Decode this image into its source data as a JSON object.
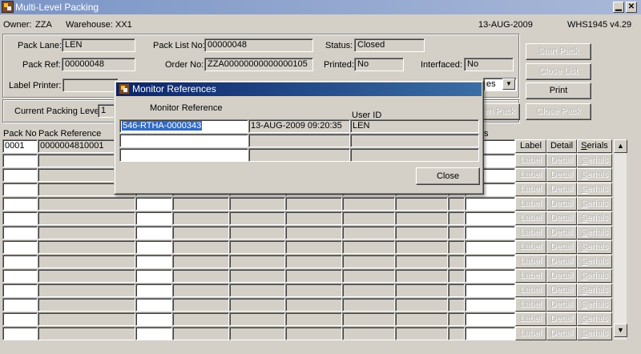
{
  "window": {
    "title": "Multi-Level Packing",
    "minimize": "▁",
    "close": "✕"
  },
  "infobar": {
    "owner_label": "Owner:",
    "owner": "ZZA",
    "warehouse_label": "Warehouse:",
    "warehouse": "XX1",
    "date": "13-AUG-2009",
    "version": "WHS1945  v4.29"
  },
  "form": {
    "pack_lane_label": "Pack Lane:",
    "pack_lane": "LEN",
    "pack_list_no_label": "Pack List No:",
    "pack_list_no": "00000048",
    "status_label": "Status:",
    "status": "Closed",
    "pack_ref_label": "Pack Ref:",
    "pack_ref": "00000048",
    "order_no_label": "Order No:",
    "order_no": "ZZA00000000000000105",
    "printed_label": "Printed:",
    "printed": "No",
    "interfaced_label": "Interfaced:",
    "interfaced": "No",
    "label_printer_label": "Label Printer:",
    "label_printer": "",
    "dropdown_value": "es",
    "current_level_label": "Current Packing Level",
    "current_level": "1"
  },
  "buttons": {
    "start_pack": "Start Pack",
    "close_list": "Close List",
    "print": "Print",
    "open_pack": "en Pack",
    "close_pack": "Close Pack"
  },
  "grid": {
    "headers": {
      "pack_no": "Pack No",
      "pack_reference": "Pack Reference",
      "status_frag": "s"
    },
    "row1": {
      "pack_no": "0001",
      "pack_reference": "0000004810001",
      "status_frag": "ed"
    },
    "btn_label": "Label",
    "btn_detail": "Detail",
    "btn_serials": "Serials"
  },
  "scroll": {
    "up": "▲",
    "down": "▼"
  },
  "dialog": {
    "title": "Monitor References",
    "col_monitor_reference": "Monitor Reference",
    "col_user_id": "User ID",
    "row1": {
      "monitor_reference": "546-RTHA-0000343",
      "datetime": "13-AUG-2009 09:20:35",
      "user_id": "LEN"
    },
    "close_button": "Close"
  }
}
